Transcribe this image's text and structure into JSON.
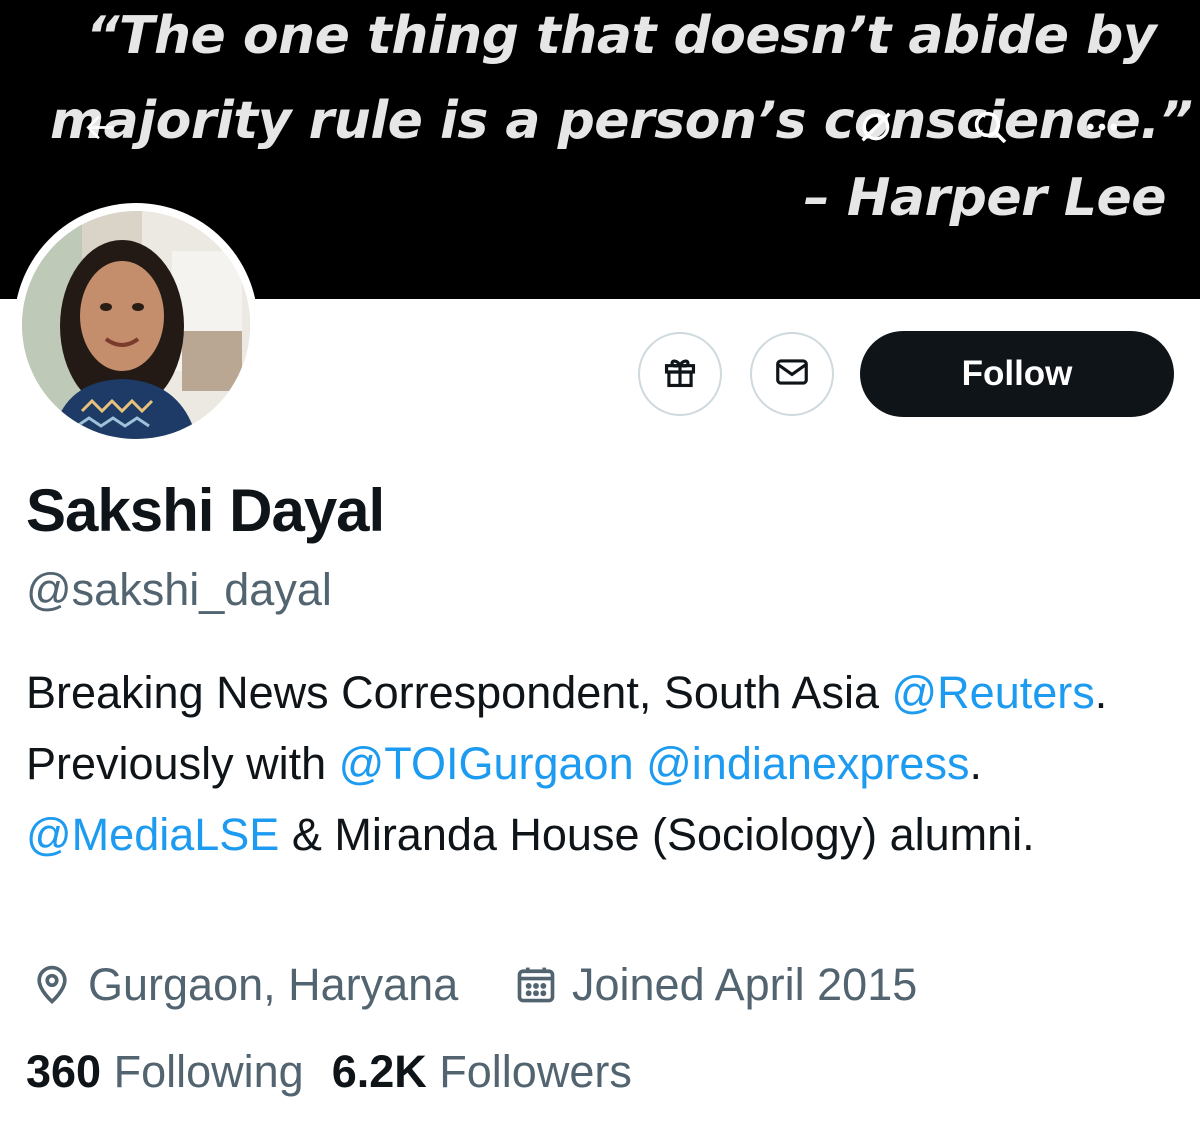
{
  "banner": {
    "quote_line1": "“The one thing that doesn’t abide by",
    "quote_line2": "majority rule is a person’s conscience.”",
    "quote_line3": "– Harper Lee"
  },
  "nav": {
    "back_icon": "arrow-left-icon",
    "link_icon": "link-off-icon",
    "search_icon": "search-icon",
    "more_icon": "more-icon"
  },
  "profile": {
    "name": "Sakshi Dayal",
    "handle": "@sakshi_dayal",
    "follow_label": "Follow",
    "bio": {
      "text1": "Breaking News Correspondent, South Asia ",
      "mention1": "@Reuters",
      "text2": ". Previously with ",
      "mention2": "@TOIGurgaon",
      "text3": " ",
      "mention3": "@indianexpress",
      "text4": ". ",
      "mention4": "@MediaLSE",
      "text5": " & Miranda House (Sociology) alumni."
    },
    "location": "Gurgaon, Haryana",
    "joined": "Joined April 2015",
    "following_count": "360",
    "following_label": "Following",
    "followers_count": "6.2K",
    "followers_label": "Followers"
  },
  "colors": {
    "link": "#1d9bf0",
    "text": "#0f1419",
    "muted": "#536471",
    "button": "#0f1419"
  }
}
